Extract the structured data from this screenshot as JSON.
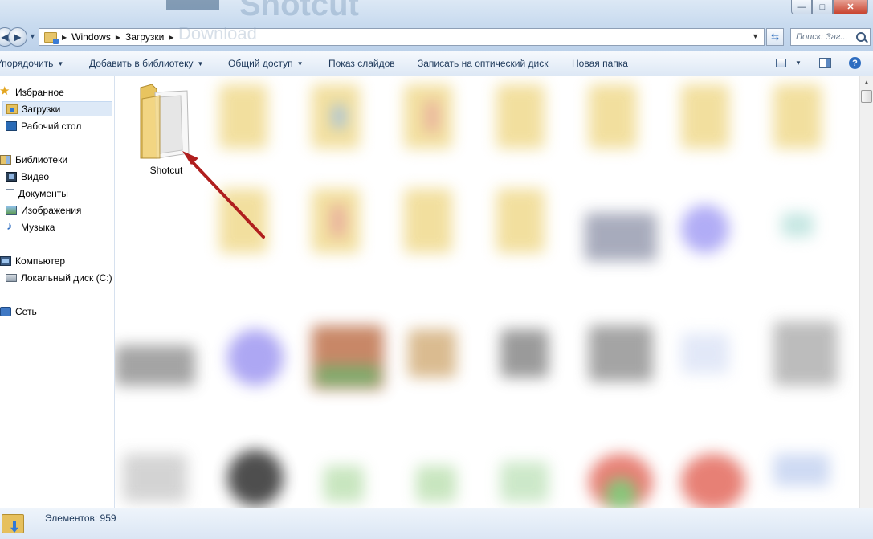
{
  "window": {
    "minimize_glyph": "—",
    "maximize_glyph": "□",
    "close_glyph": "✕"
  },
  "background_page": {
    "heading": "Shotcut",
    "subheading": "Download"
  },
  "address_bar": {
    "breadcrumbs": [
      "Windows",
      "Загрузки"
    ],
    "search_placeholder": "Поиск: Заг..."
  },
  "command_bar": {
    "organize": "Упорядочить",
    "add_to_library": "Добавить в библиотеку",
    "share": "Общий доступ",
    "slideshow": "Показ слайдов",
    "burn": "Записать на оптический диск",
    "new_folder": "Новая папка",
    "help": "?"
  },
  "nav_pane": {
    "favorites": "Избранное",
    "downloads": "Загрузки",
    "desktop": "Рабочий стол",
    "libraries": "Библиотеки",
    "video": "Видео",
    "documents": "Документы",
    "pictures": "Изображения",
    "music": "Музыка",
    "computer": "Компьютер",
    "local_disk": "Локальный диск (C:)",
    "network": "Сеть"
  },
  "content": {
    "highlighted_item": "Shotcut",
    "arrow_color": "#b01e1e"
  },
  "status_bar": {
    "item_count": "Элементов: 959"
  }
}
